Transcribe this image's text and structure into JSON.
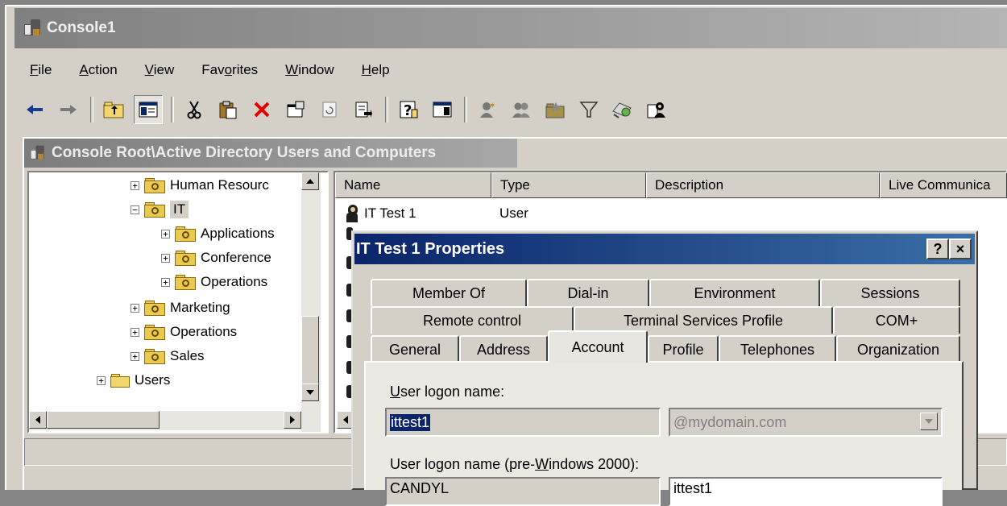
{
  "app": {
    "title": "Console1"
  },
  "menu": [
    {
      "label": "File",
      "ul": "F",
      "rest": "ile"
    },
    {
      "label": "Action",
      "ul": "A",
      "rest": "ction"
    },
    {
      "label": "View",
      "ul": "V",
      "rest": "iew"
    },
    {
      "label": "Favorites",
      "pre": "Fav",
      "ul": "o",
      "rest": "rites"
    },
    {
      "label": "Window",
      "ul": "W",
      "rest": "indow"
    },
    {
      "label": "Help",
      "ul": "H",
      "rest": "elp"
    }
  ],
  "toolbar": {
    "icons": [
      "back-arrow-icon",
      "forward-arrow-icon",
      "up-folder-icon",
      "show-hide-tree-icon",
      "cut-icon",
      "paste-icon",
      "delete-icon",
      "properties-icon",
      "refresh-icon",
      "export-list-icon",
      "help-icon",
      "action-pane-icon",
      "new-user-icon",
      "new-group-icon",
      "new-ou-icon",
      "filter-icon",
      "find-icon",
      "add-to-group-icon"
    ]
  },
  "child_window": {
    "title": "Console Root\\Active Directory Users and Computers"
  },
  "tree": [
    {
      "label": "Human Resourc",
      "level": 1,
      "type": "ou",
      "expander": "+"
    },
    {
      "label": "IT",
      "level": 1,
      "type": "ou",
      "expander": "−",
      "selected": true
    },
    {
      "label": "Applications",
      "level": 2,
      "type": "ou",
      "expander": "+"
    },
    {
      "label": "Conference",
      "level": 2,
      "type": "ou",
      "expander": "+"
    },
    {
      "label": "Operations",
      "level": 2,
      "type": "ou",
      "expander": "+"
    },
    {
      "label": "Marketing",
      "level": 1,
      "type": "ou",
      "expander": "+"
    },
    {
      "label": "Operations",
      "level": 1,
      "type": "ou",
      "expander": "+"
    },
    {
      "label": "Sales",
      "level": 1,
      "type": "ou",
      "expander": "+"
    },
    {
      "label": "Users",
      "level": 0,
      "type": "folder",
      "expander": "+"
    }
  ],
  "list": {
    "columns": [
      "Name",
      "Type",
      "Description",
      "Live Communica"
    ],
    "rows": [
      {
        "name": "IT Test 1",
        "type": "User"
      }
    ]
  },
  "dialog": {
    "title": "IT Test 1 Properties",
    "help_btn": "?",
    "close_btn": "×",
    "tabs_row1": [
      "Member Of",
      "Dial-in",
      "Environment",
      "Sessions"
    ],
    "tabs_row2": [
      "Remote control",
      "Terminal Services Profile",
      "COM+"
    ],
    "tabs_row3": [
      "General",
      "Address",
      "Account",
      "Profile",
      "Telephones",
      "Organization"
    ],
    "active_tab": "Account",
    "logon_label_ul": "U",
    "logon_label_rest": "ser logon name:",
    "logon_value": "ittest1",
    "domain_value": "@mydomain.com",
    "pre2000_label_a": "User logon name (pre-",
    "pre2000_label_ul": "W",
    "pre2000_label_b": "indows 2000):",
    "pre2000_domain": "CANDYL",
    "pre2000_value": "ittest1"
  }
}
